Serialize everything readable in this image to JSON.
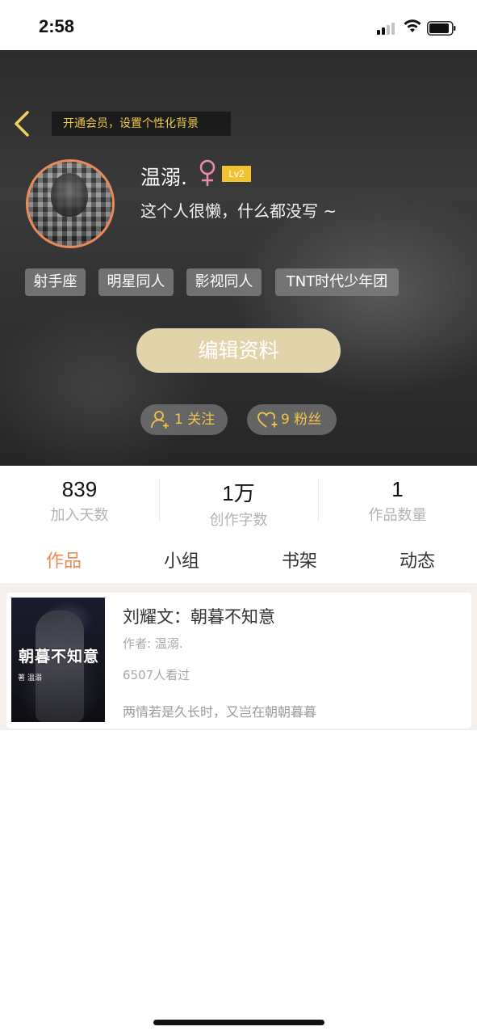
{
  "status_bar": {
    "time": "2:58"
  },
  "header": {
    "vip_banner": "开通会员，设置个性化背景",
    "username": "温溺.",
    "level": "Lv2",
    "bio": "这个人很懒，什么都没写 ~",
    "tags": [
      "射手座",
      "明星同人",
      "影视同人",
      "TNT时代少年团"
    ],
    "edit_button": "编辑资料",
    "following": "1 关注",
    "followers": "9 粉丝",
    "accent_color": "#f1c44a"
  },
  "stats": [
    {
      "value": "839",
      "label": "加入天数"
    },
    {
      "value": "1万",
      "label": "创作字数"
    },
    {
      "value": "1",
      "label": "作品数量"
    }
  ],
  "tabs": [
    {
      "label": "作品",
      "active": true
    },
    {
      "label": "小组",
      "active": false
    },
    {
      "label": "书架",
      "active": false
    },
    {
      "label": "动态",
      "active": false
    }
  ],
  "works": [
    {
      "cover_title": "朝暮不知意",
      "cover_author": "著 温溺",
      "title": "刘耀文：朝暮不知意",
      "author": "作者: 温溺.",
      "views": "6507人看过",
      "description": "两情若是久长时，又岂在朝朝暮暮"
    }
  ]
}
